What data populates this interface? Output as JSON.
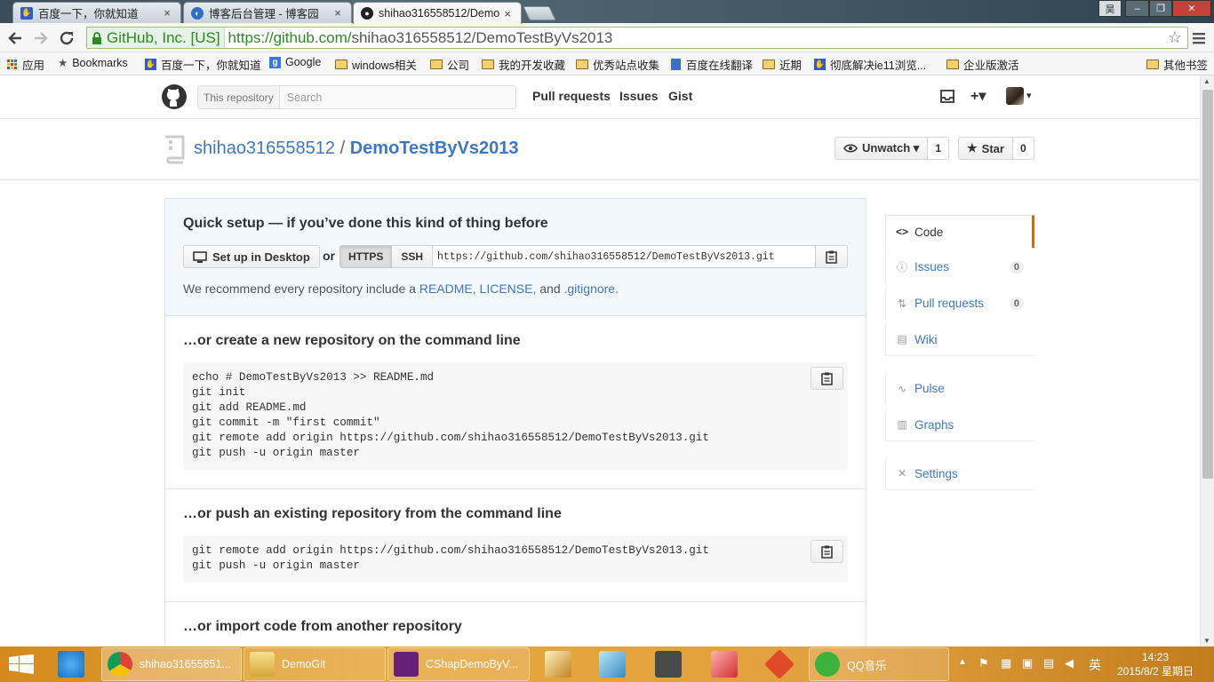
{
  "browser": {
    "tabs": [
      {
        "title": "百度一下，你就知道",
        "close": "×"
      },
      {
        "title": "博客后台管理 - 博客园",
        "close": "×"
      },
      {
        "title": "shihao316558512/Demo",
        "close": "×"
      }
    ],
    "window_controls": {
      "user": "昊",
      "minimize": "–",
      "maximize": "❐",
      "close": "✕"
    },
    "omnibox": {
      "ev_label": "GitHub, Inc. [US]",
      "url_scheme_host": "https://github.com/",
      "url_path": "shihao316558512/DemoTestByVs2013"
    },
    "bookmarks": [
      {
        "label": "应用",
        "icon": "apps-grid-icon"
      },
      {
        "label": "Bookmarks",
        "icon": "star-icon"
      },
      {
        "label": "百度一下，你就知道",
        "icon": "baidu-icon"
      },
      {
        "label": "Google",
        "icon": "google-icon"
      },
      {
        "label": "windows相关",
        "icon": "folder-icon"
      },
      {
        "label": "公司",
        "icon": "folder-icon"
      },
      {
        "label": "我的开发收藏",
        "icon": "folder-icon"
      },
      {
        "label": "优秀站点收集",
        "icon": "folder-icon"
      },
      {
        "label": "百度在线翻译",
        "icon": "translate-icon"
      },
      {
        "label": "近期",
        "icon": "folder-icon"
      },
      {
        "label": "彻底解决ie11浏览...",
        "icon": "baidu-icon"
      },
      {
        "label": "企业版激活",
        "icon": "folder-icon"
      }
    ],
    "other_bookmarks": "其他书签"
  },
  "github": {
    "header": {
      "search_scope": "This repository",
      "search_placeholder": "Search",
      "nav": [
        "Pull requests",
        "Issues",
        "Gist"
      ],
      "plus": "+▾",
      "avatar_caret": "▾"
    },
    "repo": {
      "owner": "shihao316558512",
      "separator": " / ",
      "name": "DemoTestByVs2013",
      "unwatch_label": "Unwatch ▾",
      "watch_count": "1",
      "star_label": "Star",
      "star_count": "0"
    },
    "quick_setup": {
      "title": "Quick setup — if you’ve done this kind of thing before",
      "desktop_button": "Set up in Desktop",
      "or": "or",
      "https": "HTTPS",
      "ssh": "SSH",
      "clone_url": "https://github.com/shihao316558512/DemoTestByVs2013.git",
      "recommend_prefix": "We recommend every repository include a ",
      "readme": "README,",
      "license": "LICENSE,",
      "and": " and ",
      "gitignore": ".gitignore."
    },
    "sections": [
      {
        "title": "…or create a new repository on the command line",
        "code": [
          "echo # DemoTestByVs2013 >> README.md",
          "git init",
          "git add README.md",
          "git commit -m \"first commit\"",
          "git remote add origin https://github.com/shihao316558512/DemoTestByVs2013.git",
          "git push -u origin master"
        ]
      },
      {
        "title": "…or push an existing repository from the command line",
        "code": [
          "git remote add origin https://github.com/shihao316558512/DemoTestByVs2013.git",
          "git push -u origin master"
        ]
      },
      {
        "title": "…or import code from another repository",
        "code": []
      }
    ],
    "sidenav": [
      {
        "label": "Code",
        "icon": "<>",
        "badge": ""
      },
      {
        "label": "Issues",
        "icon": "ⓘ",
        "badge": "0"
      },
      {
        "label": "Pull requests",
        "icon": "⇅",
        "badge": "0"
      },
      {
        "label": "Wiki",
        "icon": "▤",
        "badge": ""
      },
      {
        "label": "Pulse",
        "icon": "∿",
        "badge": ""
      },
      {
        "label": "Graphs",
        "icon": "▥",
        "badge": ""
      },
      {
        "label": "Settings",
        "icon": "✕",
        "badge": ""
      }
    ]
  },
  "taskbar": {
    "items": [
      {
        "label": "shihao31655851..."
      },
      {
        "label": "DemoGit"
      },
      {
        "label": "CShapDemoByV..."
      },
      {
        "label": "QQ音乐"
      }
    ],
    "ime": "英",
    "time": "14:23",
    "date": "2015/8/2 星期日"
  }
}
